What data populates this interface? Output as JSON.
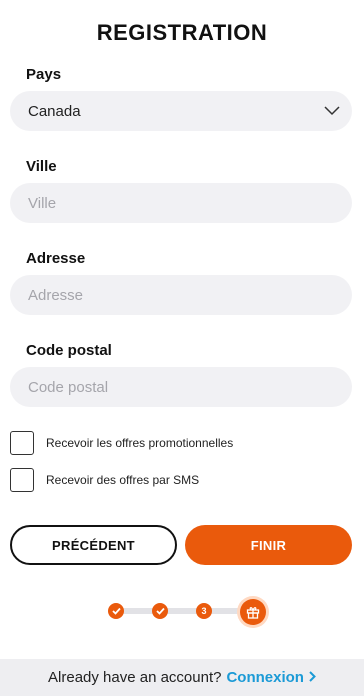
{
  "page": {
    "title": "REGISTRATION"
  },
  "form": {
    "country": {
      "label": "Pays",
      "value": "Canada"
    },
    "city": {
      "label": "Ville",
      "placeholder": "Ville",
      "value": ""
    },
    "address": {
      "label": "Adresse",
      "placeholder": "Adresse",
      "value": ""
    },
    "postal_code": {
      "label": "Code postal",
      "placeholder": "Code postal",
      "value": ""
    },
    "checkboxes": [
      {
        "label": "Recevoir les offres promotionnelles",
        "checked": false
      },
      {
        "label": "Recevoir des offres par SMS",
        "checked": false
      }
    ]
  },
  "buttons": {
    "previous": "PRÉCÉDENT",
    "finish": "FINIR"
  },
  "stepper": {
    "steps": [
      {
        "state": "done",
        "icon": "check-icon"
      },
      {
        "state": "done",
        "icon": "check-icon"
      },
      {
        "state": "current",
        "label": "3"
      },
      {
        "state": "final",
        "icon": "gift-icon"
      }
    ]
  },
  "footer": {
    "text": "Already have an account?",
    "link": "Connexion"
  },
  "colors": {
    "accent": "#ea5a0c",
    "link": "#1b9ad6",
    "field_bg": "#f1f1f4"
  }
}
